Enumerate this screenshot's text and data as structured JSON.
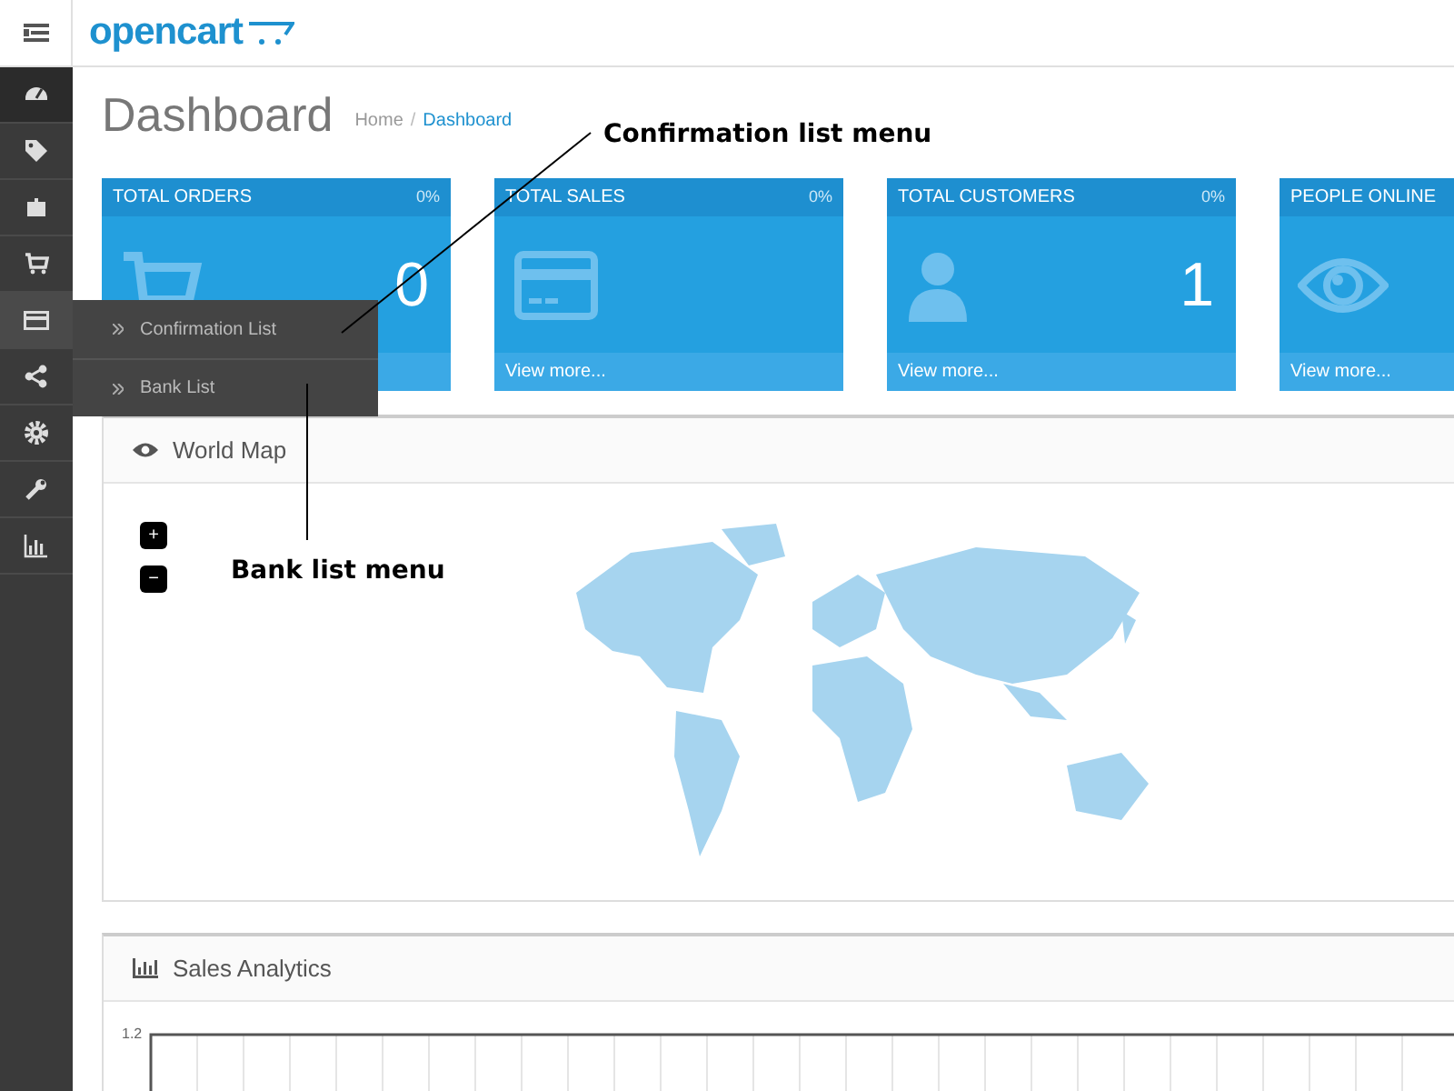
{
  "header": {
    "logo": "opencart"
  },
  "sidebar": {
    "items": [
      {
        "selected": true
      },
      {
        "selected": false
      },
      {
        "selected": false
      },
      {
        "selected": false
      },
      {
        "selected": false,
        "expanded": true,
        "children": [
          {
            "label": "Confirmation List"
          },
          {
            "label": "Bank List"
          }
        ]
      },
      {
        "selected": false
      },
      {
        "selected": false
      },
      {
        "selected": false
      },
      {
        "selected": false
      }
    ]
  },
  "page": {
    "title": "Dashboard",
    "breadcrumb": [
      {
        "label": "Home",
        "selected": false
      },
      {
        "label": "Dashboard",
        "selected": true
      }
    ],
    "breadcrumb_separator": "/"
  },
  "tiles": [
    {
      "title": "TOTAL ORDERS",
      "percent": "0%",
      "value": "0"
    },
    {
      "title": "TOTAL SALES",
      "percent": "0%",
      "link": "View more..."
    },
    {
      "title": "TOTAL CUSTOMERS",
      "percent": "0%",
      "value": "1",
      "link": "View more..."
    },
    {
      "title": "PEOPLE ONLINE",
      "link": "View more..."
    }
  ],
  "world_map": {
    "title": "World Map",
    "zoom_buttons": [
      "+",
      "−"
    ]
  },
  "sales_analytics": {
    "title": "Sales Analytics",
    "y_tick": "1.2"
  },
  "annotations": [
    {
      "text": "Confirmation list menu"
    },
    {
      "text": "Bank list menu"
    }
  ]
}
